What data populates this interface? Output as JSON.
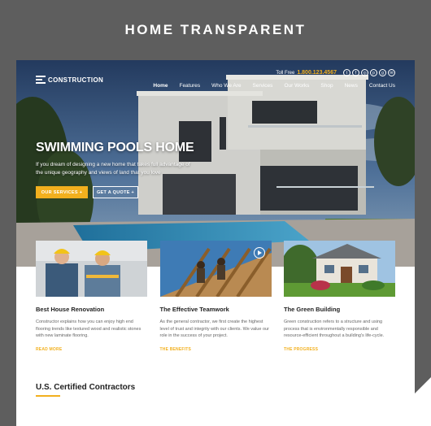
{
  "promo": {
    "title": "HOME TRANSPARENT"
  },
  "header": {
    "logo_text": "CONSTRUCTION",
    "toll_free_label": "Toll Free",
    "phone": "1.800.123.4567",
    "social_icons": [
      "twitter-icon",
      "facebook-icon",
      "instagram-icon",
      "pinterest-icon",
      "google-plus-icon",
      "email-icon"
    ]
  },
  "nav": {
    "items": [
      {
        "label": "Home",
        "active": true
      },
      {
        "label": "Features"
      },
      {
        "label": "Who We Are"
      },
      {
        "label": "Services"
      },
      {
        "label": "Our Works"
      },
      {
        "label": "Shop"
      },
      {
        "label": "News"
      },
      {
        "label": "Contact Us"
      }
    ]
  },
  "hero": {
    "title": "SWIMMING POOLS HOME",
    "subtitle": "If you dream of designing a new home that takes full advantage of the unique geography and views of land that you love",
    "primary_button": "OUR SERVICES +",
    "secondary_button": "GET A QUOTE +"
  },
  "cards": [
    {
      "title": "Best House Renovation",
      "text": "Constructor explains how you can enjoy high end flooring trends like textured wood and realistic stones with new laminate flooring.",
      "link": "READ MORE"
    },
    {
      "title": "The Effective Teamwork",
      "text": "As the general contractor, we first create the highest level of trust and integrity with our clients. We value our role in the success of your project.",
      "link": "THE BENEFITS"
    },
    {
      "title": "The Green Building",
      "text": "Green construction refers to a structure and using process that is environmentally responsible and resource-efficient throughout a building's life-cycle.",
      "link": "THE PROGRESS"
    }
  ],
  "section": {
    "title": "U.S. Certified Contractors"
  },
  "colors": {
    "accent": "#f2b01e",
    "frame": "#5e5e5e"
  }
}
